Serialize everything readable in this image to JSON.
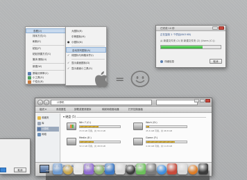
{
  "context_menu": {
    "items": [
      {
        "label": "查看(V)",
        "highlight": true
      },
      {
        "label": "排序方式(O)"
      },
      {
        "label": "刷新(E)"
      },
      {
        "label": "粘贴(P)"
      },
      {
        "label": "粘贴快捷方式(S)"
      },
      {
        "label": "撤消 删除(U)"
      },
      {
        "label": "新建(W)"
      },
      {
        "label": "屏幕分辨率(C)"
      },
      {
        "label": "小工具(G)"
      },
      {
        "label": "个性化(R)"
      }
    ]
  },
  "submenu": {
    "items": [
      {
        "label": "大图标(R)",
        "checked": false
      },
      {
        "label": "中等图标(M)",
        "checked": false
      },
      {
        "label": "小图标(N)",
        "checked": true
      },
      {
        "label": "自动排列图标(A)",
        "checked": false,
        "highlight": true
      },
      {
        "label": "将图标与网格对齐(I)",
        "checked": true
      },
      {
        "label": "显示桌面图标(D)",
        "checked": true
      },
      {
        "label": "显示桌面小工具(G)",
        "checked": true
      }
    ]
  },
  "copy_dialog": {
    "title": "已完成 10 秒",
    "line1": "正在复制 1 个项目(843 KB)",
    "line2": "从 新建文件夹 (2) 到 新建文件夹 (2) (Users (C:))",
    "progress": 0.7,
    "more": "详细信息",
    "cancel": "取消"
  },
  "explorer": {
    "address": "计算机",
    "toolbar": [
      "组织 ▾",
      "系统属性",
      "卸载或更改程序",
      "映射网络驱动器",
      "打开控制面板"
    ],
    "sidebar": [
      {
        "label": "收藏夹",
        "selected": false
      },
      {
        "label": "库",
        "selected": false
      },
      {
        "label": "计算机",
        "selected": true
      },
      {
        "label": "网络",
        "selected": false
      }
    ],
    "group": "▾ 硬盘 (5)",
    "drives": [
      {
        "name": "Win 7 (C:)",
        "cap": "15.8 GB 可用，共 30.0 GB",
        "fill": 0.47,
        "win": true
      },
      {
        "name": "Work (D:)",
        "cap": "45.6 GB 可用，共 48.8 GB",
        "fill": 0.07,
        "win": false
      },
      {
        "name": "Media (E:)",
        "cap": "32.0 GB 可用，共 48.8 GB",
        "fill": 0.34,
        "win": false
      },
      {
        "name": "Game (F:)",
        "cap": "4.49 GB 可用，共 14.8 GB",
        "fill": 0.7,
        "win": false
      }
    ],
    "status": {
      "computer_name": "NEWSUNAIR-PC",
      "name_label": "工作组: WORKGROUP",
      "memory": "内存: 2.00 GB",
      "processor": "处理器: AMD Athlon(tm) 64 X2 D..."
    }
  },
  "left_dialog": {
    "cancel": "取消"
  },
  "center": {
    "equals": "="
  },
  "dock": {
    "icons": [
      "finder-icon",
      "folder-icon",
      "mail-icon",
      "music-icon",
      "photo-icon",
      "globe-icon",
      "calendar-icon",
      "dashboard-icon",
      "chat-icon",
      "settings-icon",
      "safari-icon",
      "app-icon",
      "store-icon",
      "ball-icon",
      "video-icon"
    ],
    "colors": [
      "#6f9bd1",
      "#c9a54a",
      "#e7e7e7",
      "#8f6bd1",
      "#8bb36c",
      "#3c78c4",
      "#d8d8d8",
      "#3a3a3a",
      "#6bbf5a",
      "#7a7a7a",
      "#3d8ee0",
      "#c74a3a",
      "#d7d7d7",
      "#dd7a22",
      "#3a3a3a"
    ]
  }
}
